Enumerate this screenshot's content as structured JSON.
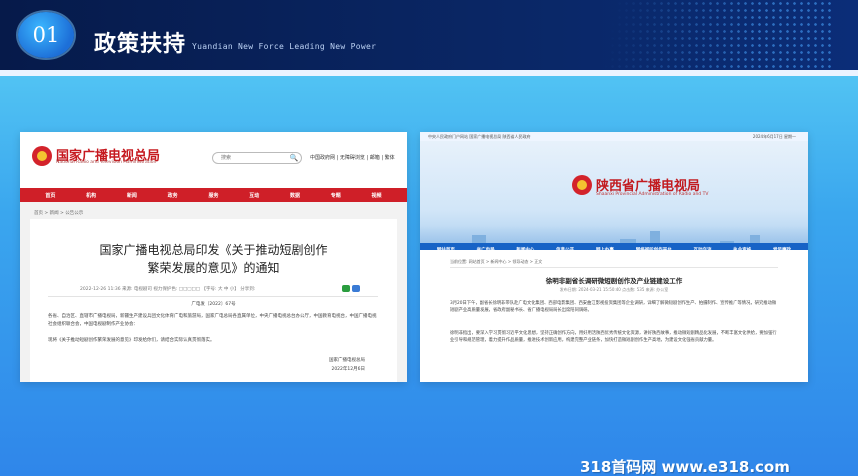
{
  "header": {
    "number": "01",
    "title": "政策扶持",
    "subtitle": "Yuandian New Force Leading New Power"
  },
  "card1": {
    "site_name": "国家广播电视总局",
    "site_name_en": "National Radio and Television Administration",
    "search_placeholder": "搜索",
    "top_links": "中国政府网 | 无障碍浏览 | 邮箱 | 繁体",
    "nav": [
      "首页",
      "机构",
      "新闻",
      "政务",
      "服务",
      "互动",
      "数据",
      "专题",
      "视频"
    ],
    "breadcrumb": "首页 > 新闻 > 公告公示",
    "title_line1": "国家广播电视总局印发《关于推动短剧创作",
    "title_line2": "繁荣发展的意见》的通知",
    "meta": "2022-12-26 11:36   来源: 电视剧司              视力保护色: □□□□□   【字号: 大 中 小】  分享到:",
    "doc_no": "广电发〔2022〕67号",
    "para1": "各省、自治区、直辖市广播电视局，新疆生产建设兵团文化体育广电和旅游局，国家广电总局各直属单位，中央广播电视总台办公厅，中国教育电视台，中国广播电视社会组织联合会，中国电视剧制作产业协会：",
    "para2": "现将《关于推动短剧创作繁荣发展的意见》印发给你们，请结合实际认真贯彻落实。",
    "sign_org": "国家广播电视总局",
    "sign_date": "2022年12月6日"
  },
  "card2": {
    "topbar_left": "中央人民政府门户网站   国家广播电视总局   陕西省人民政府",
    "topbar_right": "2024年6月17日 星期一",
    "site_name": "陕西省广播电视局",
    "site_name_en": "Shaanxi Provincial Administration of Radio and TV",
    "nav": [
      "网站首页",
      "省广电局",
      "新闻中心",
      "信息公开",
      "网上办事",
      "网络视听创作平台",
      "互动交流",
      "执业资格",
      "党风廉政"
    ],
    "breadcrumb": "当前位置: 网站首页 > 新闻中心 > 领导动态 > 正文",
    "title": "徐明非副省长调研微短剧创作及产业链建设工作",
    "meta": "发布日期: 2024-03-21 15:50:40   点击数: 535   来源: 办公室",
    "para1": "3月20日下午，副省长徐明非带队赴广电文化集团、西部电影集团、西安曲江影视投资集团等企业调研，详细了解微短剧创作生产、拍摄制作、宣传推广等情况，研究推动微短剧产业高质量发展，省政府副秘书长、省广播电视局局长出席陪同调研。",
    "para2": "徐明非指出，要深入学习贯彻习近平文化思想，坚持正确创作方向，用好用活陕西优秀传统文化资源，讲好陕西故事，推动微短剧精品化发展，不断丰富文化供给，要加强行业引导和规范管理，着力提升作品质量，推进技术创新应用，构建完整产业链条，加快打造微短剧创作生产高地，为建设文化强省贡献力量。"
  },
  "watermark": "318首码网 www.e318.com"
}
